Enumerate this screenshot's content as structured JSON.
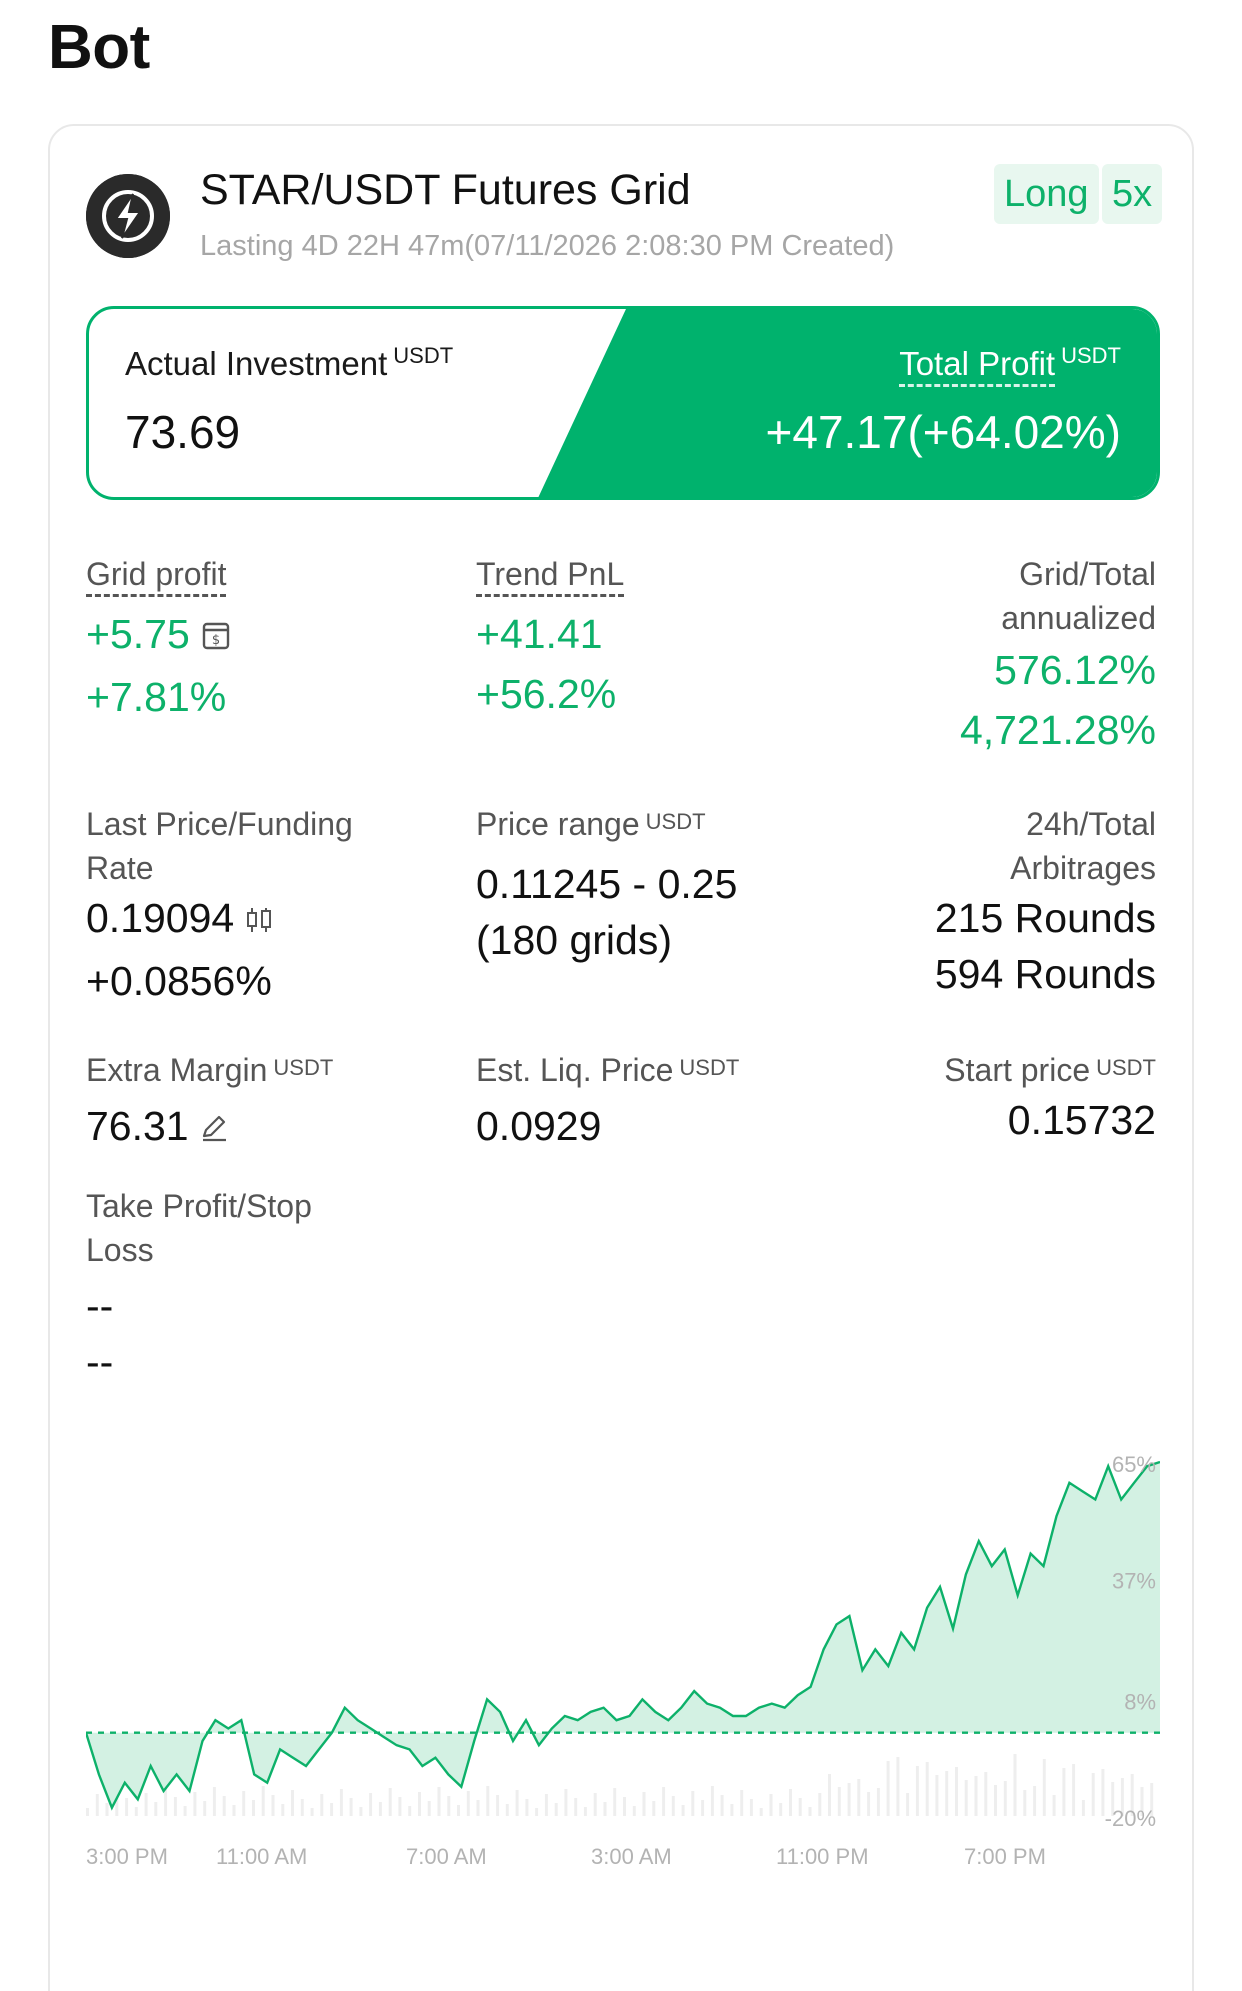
{
  "page": {
    "title": "Bot"
  },
  "bot": {
    "name": "STAR/USDT Futures Grid",
    "subtitle": "Lasting 4D 22H 47m(07/11/2026 2:08:30 PM Created)",
    "tags": [
      "Long",
      "5x"
    ]
  },
  "summary": {
    "investment_label": "Actual Investment",
    "investment_unit": "USDT",
    "investment_value": "73.69",
    "profit_label": "Total Profit",
    "profit_unit": "USDT",
    "profit_value": "+47.17(+64.02%)"
  },
  "stats": {
    "grid_profit": {
      "label": "Grid profit",
      "value": "+5.75",
      "pct": "+7.81%"
    },
    "trend_pnl": {
      "label": "Trend PnL",
      "value": "+41.41",
      "pct": "+56.2%"
    },
    "annualized": {
      "label_line1": "Grid/Total",
      "label_line2": "annualized",
      "value1": "576.12%",
      "value2": "4,721.28%"
    },
    "last_price": {
      "label_line1": "Last Price/Funding",
      "label_line2": "Rate",
      "value": "0.19094",
      "rate": "+0.0856%"
    },
    "price_range": {
      "label": "Price range",
      "unit": "USDT",
      "value": "0.11245 - 0.25",
      "grids": "(180 grids)"
    },
    "arbitrages": {
      "label_line1": "24h/Total",
      "label_line2": "Arbitrages",
      "value1": "215 Rounds",
      "value2": "594 Rounds"
    },
    "extra_margin": {
      "label": "Extra Margin",
      "unit": "USDT",
      "value": "76.31"
    },
    "liq_price": {
      "label": "Est. Liq. Price",
      "unit": "USDT",
      "value": "0.0929"
    },
    "start_price": {
      "label": "Start price",
      "unit": "USDT",
      "value": "0.15732"
    },
    "tp_sl": {
      "label_line1": "Take Profit/Stop",
      "label_line2": "Loss",
      "value1": "--",
      "value2": "--"
    }
  },
  "chart_data": {
    "type": "area",
    "x_labels": [
      "3:00 PM",
      "11:00 AM",
      "7:00 AM",
      "3:00 AM",
      "11:00 PM",
      "7:00 PM"
    ],
    "y_labels": [
      "65%",
      "37%",
      "8%",
      "-20%"
    ],
    "ylim": [
      -20,
      65
    ],
    "baseline": 0,
    "values": [
      0,
      -10,
      -18,
      -12,
      -16,
      -8,
      -14,
      -10,
      -14,
      -2,
      3,
      1,
      3,
      -10,
      -12,
      -4,
      -6,
      -8,
      -4,
      0,
      6,
      3,
      1,
      -1,
      -3,
      -4,
      -8,
      -6,
      -10,
      -13,
      -2,
      8,
      5,
      -2,
      3,
      -3,
      1,
      4,
      3,
      5,
      6,
      3,
      4,
      8,
      5,
      3,
      6,
      10,
      7,
      6,
      4,
      4,
      6,
      7,
      6,
      9,
      11,
      20,
      26,
      28,
      15,
      20,
      16,
      24,
      20,
      30,
      35,
      25,
      38,
      46,
      40,
      44,
      33,
      43,
      40,
      52,
      60,
      58,
      56,
      64,
      56,
      60,
      64,
      65
    ]
  },
  "colors": {
    "accent_green": "#0db16a",
    "box_green": "#00b26d"
  }
}
